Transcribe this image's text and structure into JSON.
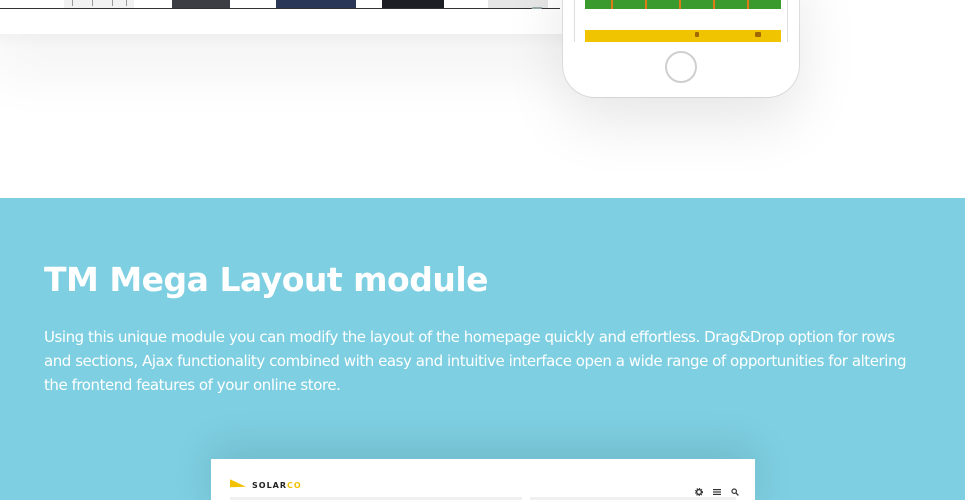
{
  "module": {
    "title": "TM Mega Layout module",
    "description": "Using this unique module you can modify the layout of the homepage quickly and effortless. Drag&Drop option for rows and sections, Ajax functionality combined with easy and intuitive interface open a wide range of opportunities for altering the frontend features of your online store."
  },
  "preview": {
    "logo_main": "SOLAR",
    "logo_accent": "CO",
    "icons": [
      "gear-icon",
      "menu-icon",
      "search-icon"
    ]
  },
  "colors": {
    "section_background": "#7dcfe1",
    "logo_accent": "#f2c200",
    "title_text": "#ffffff"
  }
}
